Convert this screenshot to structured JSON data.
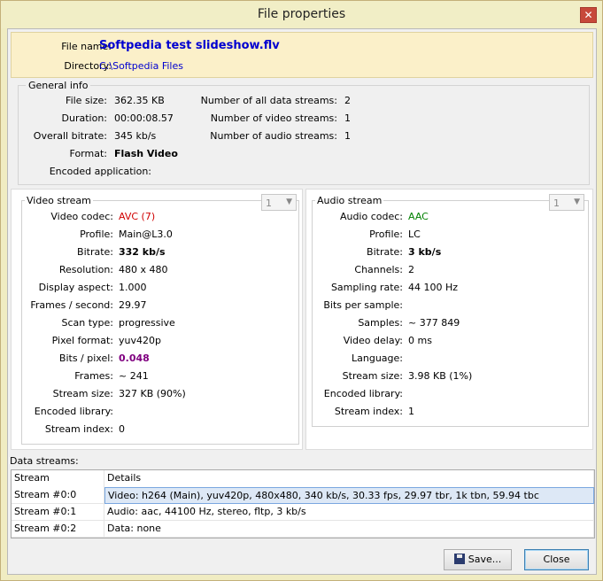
{
  "window": {
    "title": "File properties",
    "close_glyph": "✕"
  },
  "file": {
    "name_label": "File name:",
    "name": "Softpedia test slideshow.flv",
    "dir_label": "Directory:",
    "dir": "C:\\Softpedia Files"
  },
  "general": {
    "title": "General info",
    "left": [
      {
        "label": "File size:",
        "value": "362.35 KB"
      },
      {
        "label": "Duration:",
        "value": "00:00:08.57"
      },
      {
        "label": "Overall bitrate:",
        "value": "345 kb/s"
      },
      {
        "label": "Format:",
        "value": "Flash Video"
      },
      {
        "label": "Encoded application:",
        "value": ""
      }
    ],
    "right": [
      {
        "label": "Number of all data streams:",
        "value": "2"
      },
      {
        "label": "Number of video streams:",
        "value": "1"
      },
      {
        "label": "Number of audio streams:",
        "value": "1"
      }
    ]
  },
  "video": {
    "title": "Video stream",
    "selector": "1",
    "rows": [
      {
        "label": "Video codec:",
        "value": "AVC (7)"
      },
      {
        "label": "Profile:",
        "value": "Main@L3.0"
      },
      {
        "label": "Bitrate:",
        "value": "332 kb/s"
      },
      {
        "label": "Resolution:",
        "value": "480 x 480"
      },
      {
        "label": "Display aspect:",
        "value": "1.000"
      },
      {
        "label": "Frames / second:",
        "value": "29.97"
      },
      {
        "label": "Scan type:",
        "value": "progressive"
      },
      {
        "label": "Pixel format:",
        "value": "yuv420p"
      },
      {
        "label": "Bits / pixel:",
        "value": "0.048"
      },
      {
        "label": "Frames:",
        "value": "~ 241"
      },
      {
        "label": "Stream size:",
        "value": "327 KB (90%)"
      },
      {
        "label": "Encoded library:",
        "value": ""
      },
      {
        "label": "Stream index:",
        "value": "0"
      }
    ]
  },
  "audio": {
    "title": "Audio stream",
    "selector": "1",
    "rows": [
      {
        "label": "Audio codec:",
        "value": "AAC"
      },
      {
        "label": "Profile:",
        "value": "LC"
      },
      {
        "label": "Bitrate:",
        "value": "3 kb/s"
      },
      {
        "label": "Channels:",
        "value": "2"
      },
      {
        "label": "Sampling rate:",
        "value": "44 100 Hz"
      },
      {
        "label": "Bits per sample:",
        "value": ""
      },
      {
        "label": "Samples:",
        "value": "~ 377 849"
      },
      {
        "label": "Video delay:",
        "value": "0 ms"
      },
      {
        "label": "Language:",
        "value": ""
      },
      {
        "label": "Stream size:",
        "value": "3.98 KB (1%)"
      },
      {
        "label": "Encoded library:",
        "value": ""
      },
      {
        "label": "Stream index:",
        "value": "1"
      }
    ]
  },
  "streams": {
    "label": "Data streams:",
    "headers": [
      "Stream",
      "Details"
    ],
    "rows": [
      {
        "stream": "Stream #0:0",
        "details": "Video: h264 (Main), yuv420p, 480x480, 340 kb/s, 30.33 fps, 29.97 tbr, 1k tbn, 59.94 tbc"
      },
      {
        "stream": "Stream #0:1",
        "details": "Audio: aac, 44100 Hz, stereo, fltp, 3 kb/s"
      },
      {
        "stream": "Stream #0:2",
        "details": "Data: none"
      }
    ]
  },
  "buttons": {
    "save": "Save...",
    "close": "Close"
  }
}
